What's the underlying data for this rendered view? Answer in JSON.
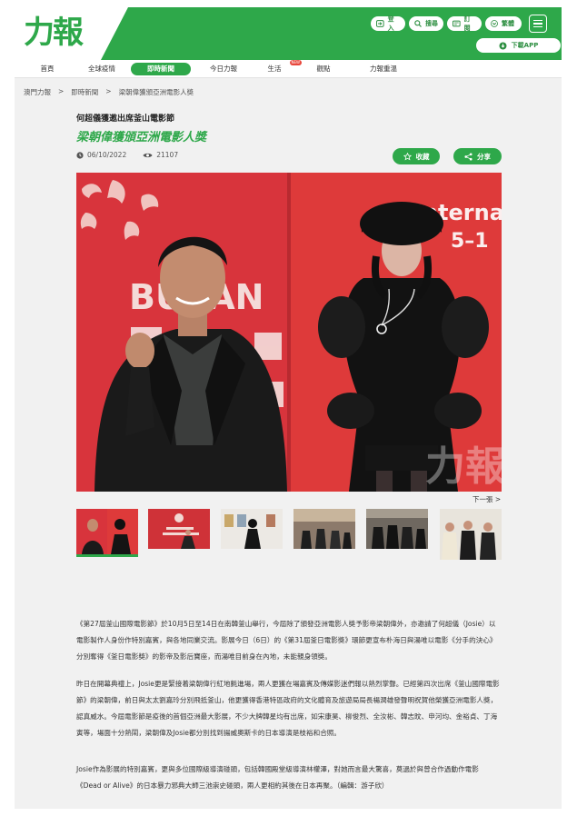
{
  "header": {
    "logo_text": "力報",
    "login": "登入",
    "search": "搜尋",
    "subscribe": "訂閱",
    "language": "繁體",
    "download_app": "下載APP"
  },
  "nav": {
    "items": [
      {
        "label": "首頁"
      },
      {
        "label": "全球疫情"
      },
      {
        "label": "即時新聞"
      },
      {
        "label": "今日力報"
      },
      {
        "label": "生活"
      },
      {
        "label": "觀點"
      },
      {
        "label": "力報重溫"
      }
    ],
    "new_badge": "NEW"
  },
  "breadcrumb": [
    "澳門力報",
    ">",
    "即時新聞",
    ">",
    "梁朝偉獲頒亞洲電影人獎"
  ],
  "article": {
    "kicker": "何超儀獲邀出席釜山電影節",
    "headline": "梁朝偉獲頒亞洲電影人獎",
    "date": "06/10/2022",
    "views": "21107",
    "favorite_label": "收藏",
    "share_label": "分享",
    "next_label": "下一張 >",
    "hero_text": {
      "left_sign": "BUSAN",
      "right_sign": "Internat",
      "right_sign2": "5–1",
      "watermark": "力報"
    },
    "paragraphs": [
      "《第27屆釜山國際電影節》於10月5日至14日在南韓釜山舉行，今屆除了頒發亞洲電影人獎予影帝梁朝偉外，亦邀請了何超儀（Josie）以電影製作人身份作特別嘉賓，與各地同業交流。影展今日（6日）的《第31屆釜日電影獎》環節更宣布朴海日與湯唯以電影《分手的決心》分別奪得《釜日電影獎》的影帝及影后寶座，而湯唯目前身在內地，未能親身領獎。",
      "昨日在開幕典禮上，Josie更是緊接着梁朝偉行紅地氈進場，兩人更獲在場嘉賓及傳媒影迷們報以熱烈掌聲。已經第四次出席《釜山國際電影節》的梁朝偉，前日與太太劉嘉玲分別飛抵釜山，他更獲得香港特區政府的文化體育及旅遊局局長楊潤雄發聲明祝賀他榮獲亞洲電影人獎，認真威水。今屆電影節是疫後的首個亞洲最大影展，不少大牌韓星均有出席，如宋康昊、柳俊烈、全汝彬、韓志旼、申河均、金裕貞、丁海寅等，場面十分熱鬧，梁朝偉及Josie都分別找到揚威奧斯卡的日本導演是枝裕和合照。",
      "Josie作為影展的特別嘉賓，更與多位國際級導演碰頭，包括韓國殿堂級導演林權澤，對她而言最大驚喜，莫過於與曾合作過動作電影《Dead or Alive》的日本暴力邪典大師三池崇史碰頭，兩人更相約其後在日本再聚。（編輯：游子欣）"
    ]
  },
  "colors": {
    "brand_green": "#2ea84a",
    "red_backdrop": "#d8343c"
  }
}
